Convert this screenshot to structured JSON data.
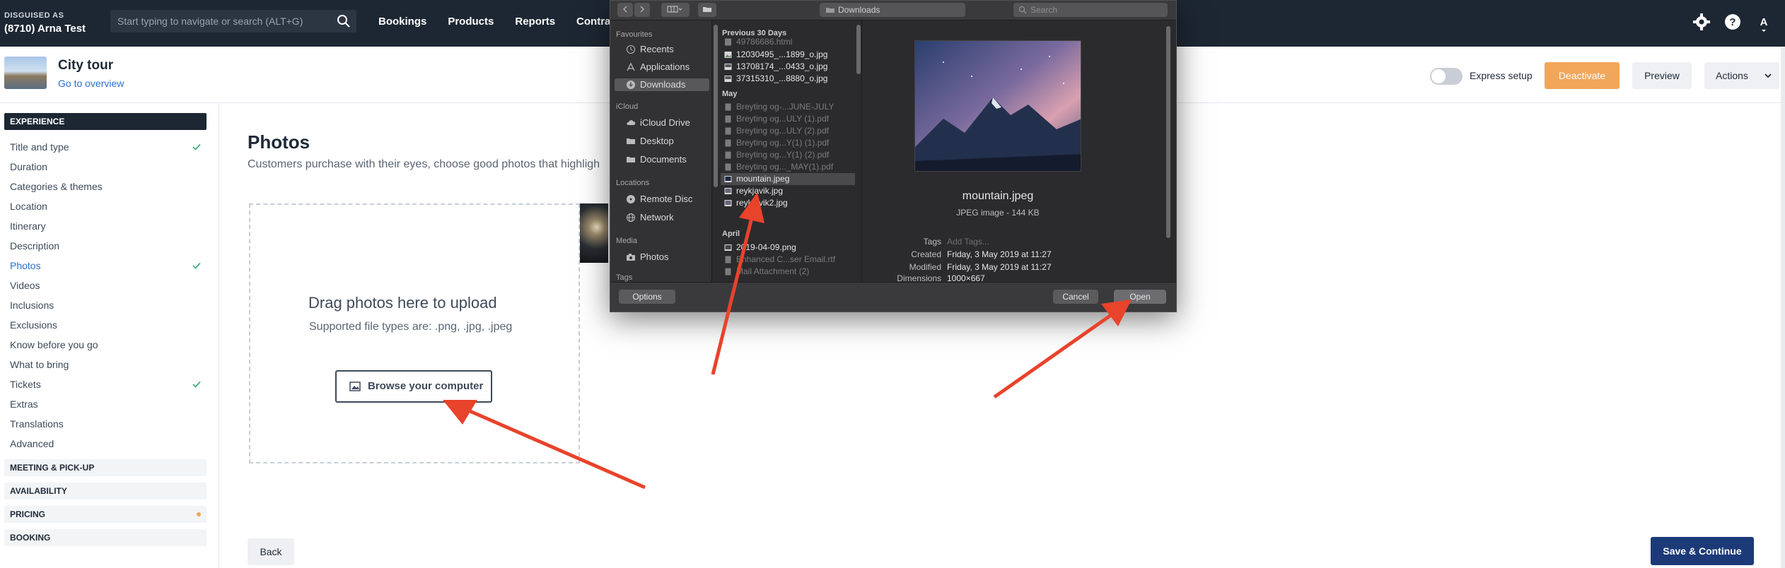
{
  "topnav": {
    "disguised_label": "DISGUISED AS",
    "account": "(8710) Arna Test",
    "search_placeholder": "Start typing to navigate or search (ALT+G)",
    "links": [
      "Bookings",
      "Products",
      "Reports",
      "Contract"
    ],
    "avatar_initial": "A"
  },
  "product": {
    "title": "City tour",
    "overview_link": "Go to overview",
    "express_setup": "Express setup",
    "deactivate": "Deactivate",
    "preview": "Preview",
    "actions": "Actions"
  },
  "sidebar": {
    "experience_header": "EXPERIENCE",
    "items": [
      {
        "label": "Title and type",
        "checked": true
      },
      {
        "label": "Duration",
        "checked": false
      },
      {
        "label": "Categories & themes",
        "checked": false
      },
      {
        "label": "Location",
        "checked": false
      },
      {
        "label": "Itinerary",
        "checked": false
      },
      {
        "label": "Description",
        "checked": false
      },
      {
        "label": "Photos",
        "checked": true,
        "active": true
      },
      {
        "label": "Videos",
        "checked": false
      },
      {
        "label": "Inclusions",
        "checked": false
      },
      {
        "label": "Exclusions",
        "checked": false
      },
      {
        "label": "Know before you go",
        "checked": false
      },
      {
        "label": "What to bring",
        "checked": false
      },
      {
        "label": "Tickets",
        "checked": true
      },
      {
        "label": "Extras",
        "checked": false
      },
      {
        "label": "Translations",
        "checked": false
      },
      {
        "label": "Advanced",
        "checked": false
      }
    ],
    "sections": [
      "MEETING & PICK-UP",
      "AVAILABILITY",
      "PRICING",
      "BOOKING"
    ]
  },
  "main": {
    "title": "Photos",
    "subtitle": "Customers purchase with their eyes, choose good photos that highligh",
    "drop_title": "Drag photos here to upload",
    "drop_sub": "Supported file types are: .png, .jpg, .jpeg",
    "browse": "Browse your computer",
    "back": "Back",
    "save": "Save & Continue"
  },
  "dialog": {
    "location": "Downloads",
    "search_placeholder": "Search",
    "sidebar": {
      "favourites": "Favourites",
      "fav_items": [
        "Recents",
        "Applications",
        "Downloads"
      ],
      "icloud": "iCloud",
      "icloud_items": [
        "iCloud Drive",
        "Desktop",
        "Documents"
      ],
      "locations": "Locations",
      "loc_items": [
        "Remote Disc",
        "Network"
      ],
      "media": "Media",
      "media_items": [
        "Photos"
      ],
      "tags": "Tags"
    },
    "groups": [
      {
        "name": "Previous 30 Days",
        "files": [
          {
            "name": "49786686.html",
            "dim": true
          },
          {
            "name": "12030495_...1899_o.jpg",
            "dim": false
          },
          {
            "name": "13708174_...0433_o.jpg",
            "dim": false
          },
          {
            "name": "37315310_...8880_o.jpg",
            "dim": false
          }
        ]
      },
      {
        "name": "May",
        "files": [
          {
            "name": "Breyting og-...JUNE-JULY",
            "dim": true
          },
          {
            "name": "Breyting og...ULY (1).pdf",
            "dim": true
          },
          {
            "name": "Breyting og...ULY (2).pdf",
            "dim": true
          },
          {
            "name": "Breyting og...Y(1) (1).pdf",
            "dim": true
          },
          {
            "name": "Breyting og...Y(1) (2).pdf",
            "dim": true
          },
          {
            "name": "Breyting og..._MAY(1).pdf",
            "dim": true
          },
          {
            "name": "mountain.jpeg",
            "dim": false,
            "selected": true
          },
          {
            "name": "reykjavik.jpg",
            "dim": false
          },
          {
            "name": "reykjavik2.jpg",
            "dim": false
          }
        ]
      },
      {
        "name": "April",
        "files": [
          {
            "name": "2019-04-09.png",
            "dim": false
          },
          {
            "name": "Enhanced C...ser Email.rtf",
            "dim": true
          },
          {
            "name": "Mail Attachment (2)",
            "dim": true
          }
        ]
      }
    ],
    "preview": {
      "name": "mountain.jpeg",
      "kind": "JPEG image - 144 KB",
      "meta": [
        {
          "key": "Tags",
          "value": "Add Tags...",
          "placeholder": true
        },
        {
          "key": "Created",
          "value": "Friday, 3 May 2019 at 11:27"
        },
        {
          "key": "Modified",
          "value": "Friday, 3 May 2019 at 11:27"
        },
        {
          "key": "Dimensions",
          "value": "1000×667"
        }
      ]
    },
    "options": "Options",
    "cancel": "Cancel",
    "open": "Open"
  },
  "colors": {
    "nav_bg": "#1d2733",
    "accent_blue": "#2c6fd1",
    "deactivate": "#f2a65a",
    "save": "#1c3a78",
    "annotation_arrow": "#e8432b"
  }
}
